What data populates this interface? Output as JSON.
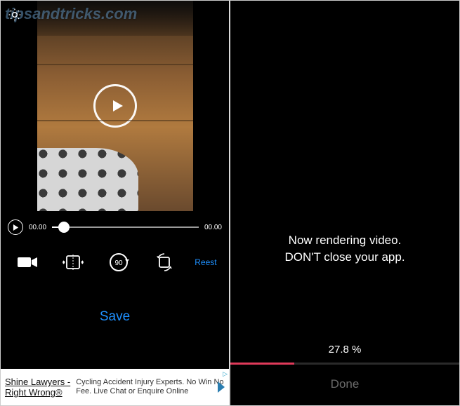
{
  "watermark": "tipsandtricks.com",
  "left_pane": {
    "settings_icon": "gear-icon",
    "play_icon": "play-icon",
    "scrubber": {
      "current_time": "00.00",
      "total_time": "00.00",
      "progress_pct": 8
    },
    "tools": {
      "camera_icon": "camera-icon",
      "flip_icon": "flip-horizontal-icon",
      "rotate_icon": "rotate-90-icon",
      "rotate_label": "90",
      "mirror_icon": "rotate-mirror-icon",
      "reset_label": "Reest"
    },
    "save_label": "Save",
    "ad": {
      "title": "Shine Lawyers -",
      "subtitle": "Right Wrong®",
      "body_line1": "Cycling Accident Injury Experts. No Win No",
      "body_line2": "Fee. Live Chat or Enquire Online",
      "badge": "▷"
    }
  },
  "right_pane": {
    "message_line1": "Now rendering video.",
    "message_line2": "DON'T close your app.",
    "progress_pct_label": "27.8 %",
    "progress_pct": 27.8,
    "done_label": "Done"
  },
  "colors": {
    "accent": "#1e90ff",
    "progress": "#e03a5a"
  }
}
